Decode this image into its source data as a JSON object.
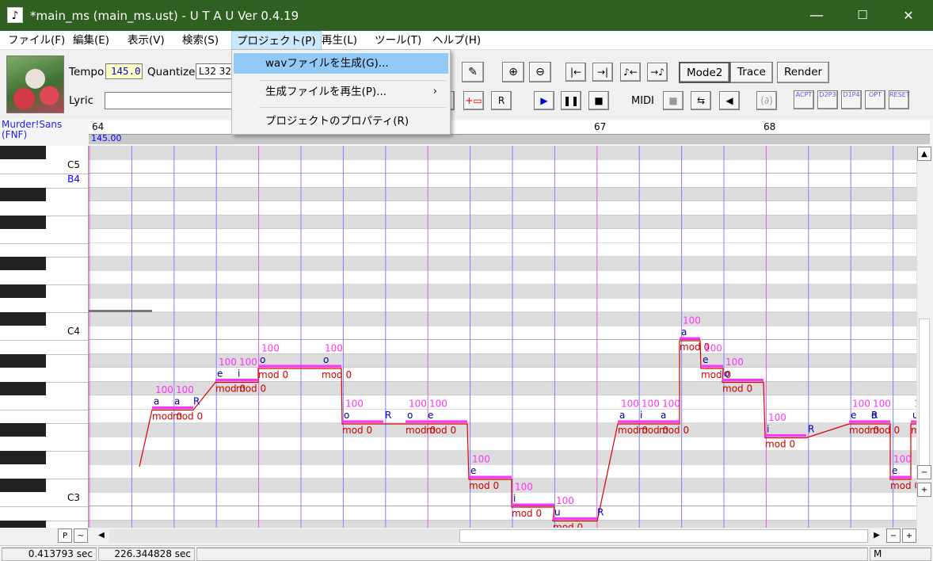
{
  "window": {
    "title": "*main_ms (main_ms.ust) - U T A U Ver 0.4.19",
    "app_icon": "music-note-icon",
    "minimize": "—",
    "maximize": "☐",
    "close": "✕"
  },
  "menu": [
    {
      "label": "ファイル(F)"
    },
    {
      "label": "編集(E)"
    },
    {
      "label": "表示(V)"
    },
    {
      "label": "検索(S)"
    },
    {
      "label": "プロジェクト(P)"
    },
    {
      "label": "再生(L)"
    },
    {
      "label": "ツール(T)"
    },
    {
      "label": "ヘルプ(H)"
    }
  ],
  "project_menu": {
    "items": [
      {
        "label": "wavファイルを生成(G)..."
      },
      {
        "label": "生成ファイルを再生(P)...",
        "submenu_arrow": "›"
      },
      {
        "label": "プロジェクトのプロパティ(R)"
      }
    ]
  },
  "toolbar": {
    "tempo_label": "Tempo",
    "tempo_value": "145.0",
    "quantize_label": "Quantize",
    "quantize_value": "L32 32",
    "lyric_label": "Lyric",
    "lyric_value": "",
    "midi_label": "MIDI",
    "mode2": "Mode2",
    "trace": "Trace",
    "render": "Render",
    "pencil": "✎",
    "zoom_in": "⊕",
    "zoom_out": "⊖",
    "go_start": "|←",
    "go_end": "→|",
    "note_left": "♪←",
    "note_right": "→♪",
    "erase_label": "R",
    "add_label": "R",
    "play": "▶",
    "pause": "❚❚",
    "stop": "■",
    "midi_rec": "■",
    "midi_sync": "⇆",
    "midi_speaker": "◀",
    "ab": "(∂)",
    "plugins": [
      "ACPT",
      "D2P3",
      "D1P4",
      "OPT",
      "RESET"
    ]
  },
  "track": {
    "singer": "Murder!Sans\n(FNF)",
    "measures": [
      "64",
      "67",
      "68"
    ],
    "tempo_mark": "145.00"
  },
  "piano": {
    "labels": [
      "C5",
      "B4",
      "C4",
      "C3"
    ],
    "highlight_label_color": "#0000ff"
  },
  "notes": [
    {
      "lyric": "a",
      "vel": "100",
      "mod": "mod 0"
    },
    {
      "lyric": "a",
      "vel": "100",
      "mod": "mod 0"
    },
    {
      "lyric": "R",
      "vel": "",
      "mod": ""
    },
    {
      "lyric": "e",
      "vel": "100",
      "mod": "mod 0"
    },
    {
      "lyric": "i",
      "vel": "100",
      "mod": "mod 0"
    },
    {
      "lyric": "o",
      "vel": "100",
      "mod": "mod 0"
    },
    {
      "lyric": "o",
      "vel": "100",
      "mod": "mod 0"
    },
    {
      "lyric": "o",
      "vel": "100",
      "mod": "mod 0"
    },
    {
      "lyric": "R",
      "vel": "",
      "mod": ""
    },
    {
      "lyric": "o",
      "vel": "100",
      "mod": "mod 0"
    },
    {
      "lyric": "e",
      "vel": "100",
      "mod": "mod 0"
    },
    {
      "lyric": "e",
      "vel": "100",
      "mod": "mod 0"
    },
    {
      "lyric": "i",
      "vel": "100",
      "mod": "mod 0"
    },
    {
      "lyric": "u",
      "vel": "100",
      "mod": "mod 0"
    },
    {
      "lyric": "R",
      "vel": "",
      "mod": ""
    },
    {
      "lyric": "a",
      "vel": "100",
      "mod": "mod 0"
    },
    {
      "lyric": "i",
      "vel": "100",
      "mod": "mod 0"
    },
    {
      "lyric": "a",
      "vel": "100",
      "mod": "mod 0"
    },
    {
      "lyric": "a",
      "vel": "100",
      "mod": "mod 0"
    },
    {
      "lyric": "e",
      "vel": "100",
      "mod": "mod 0"
    },
    {
      "lyric": "o",
      "vel": "100",
      "mod": "mod 0"
    },
    {
      "lyric": "i",
      "vel": "100",
      "mod": "mod 0"
    },
    {
      "lyric": "R",
      "vel": "",
      "mod": ""
    },
    {
      "lyric": "e",
      "vel": "100",
      "mod": "mod 0"
    },
    {
      "lyric": "R",
      "vel": "",
      "mod": ""
    },
    {
      "lyric": "o",
      "vel": "100",
      "mod": "mod 0"
    },
    {
      "lyric": "e",
      "vel": "100",
      "mod": "mod 0"
    },
    {
      "lyric": "u",
      "vel": "100",
      "mod": "mod 0"
    }
  ],
  "bottom": {
    "p_label": "P",
    "tilde_label": "~",
    "left": "◀",
    "right": "▶",
    "minus": "−",
    "plus": "+"
  },
  "vscroll": {
    "up": "▲",
    "minus": "−",
    "plus": "+"
  },
  "status": {
    "time1": "0.413793 sec",
    "time2": "226.344828 sec",
    "mode": "M"
  },
  "colors": {
    "titlebar": "#2f5f21",
    "note": "#ff33ff",
    "pitch": "#dd0000",
    "grid_beat": "#8080ff",
    "grid_bar": "#e060e0"
  }
}
